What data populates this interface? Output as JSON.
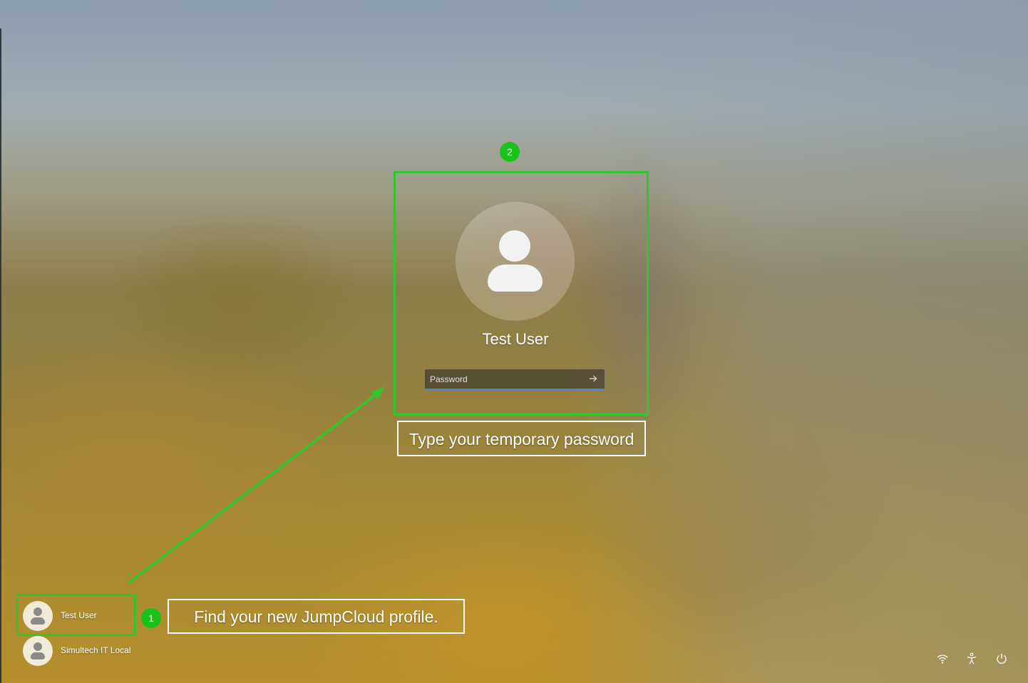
{
  "login": {
    "selected_user": "Test User",
    "password_placeholder": "Password",
    "submit_icon": "arrow-right-icon"
  },
  "user_list": [
    {
      "name": "Test User"
    },
    {
      "name": "Simultech IT Local"
    }
  ],
  "annotations": {
    "step1_number": "1",
    "step1_text": "Find your new JumpCloud profile.",
    "step2_number": "2",
    "step2_text": "Type your temporary password",
    "highlight_color": "#2ec72e",
    "badge_color": "#19c319"
  },
  "system_icons": [
    "wifi-icon",
    "accessibility-icon",
    "power-icon"
  ]
}
